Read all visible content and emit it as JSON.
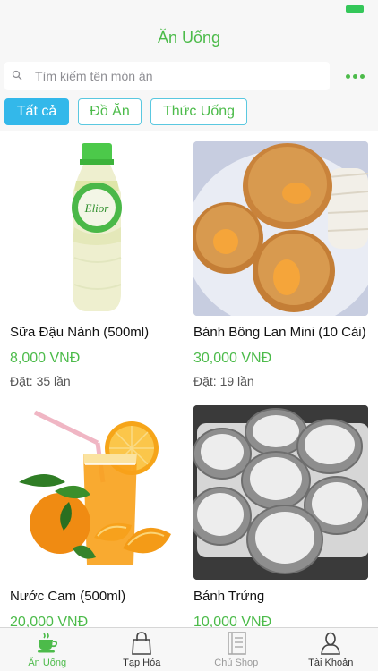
{
  "header": {
    "title": "Ăn Uống"
  },
  "search": {
    "placeholder": "Tìm kiếm tên món ăn"
  },
  "filters": [
    {
      "label": "Tất cả",
      "active": true
    },
    {
      "label": "Đồ Ăn",
      "active": false
    },
    {
      "label": "Thức Uống",
      "active": false
    }
  ],
  "products": [
    {
      "name": "Sữa Đậu Nành (500ml)",
      "price": "8,000 VNĐ",
      "orders": "Đặt: 35 lần",
      "image": "soy-milk-bottle",
      "bottle_label": "Elior"
    },
    {
      "name": "Bánh Bông Lan Mini (10 Cái)",
      "price": "30,000 VNĐ",
      "orders": "Đặt: 19 lần",
      "image": "mini-sponge-cakes"
    },
    {
      "name": "Nước Cam (500ml)",
      "price": "20,000 VNĐ",
      "orders": "",
      "image": "orange-juice"
    },
    {
      "name": "Bánh Trứng",
      "price": "10,000 VNĐ",
      "orders": "",
      "image": "egg-tarts"
    }
  ],
  "tabbar": [
    {
      "label": "Ăn Uống",
      "icon": "coffee-cup-icon",
      "state": "active"
    },
    {
      "label": "Tạp Hóa",
      "icon": "shopping-bag-icon",
      "state": "normal"
    },
    {
      "label": "Chủ Shop",
      "icon": "notebook-icon",
      "state": "disabled"
    },
    {
      "label": "Tài Khoản",
      "icon": "user-icon",
      "state": "normal"
    }
  ],
  "colors": {
    "accent": "#4cbb4a",
    "active_chip": "#33b8ea",
    "chip_border": "#5ac8e0"
  }
}
